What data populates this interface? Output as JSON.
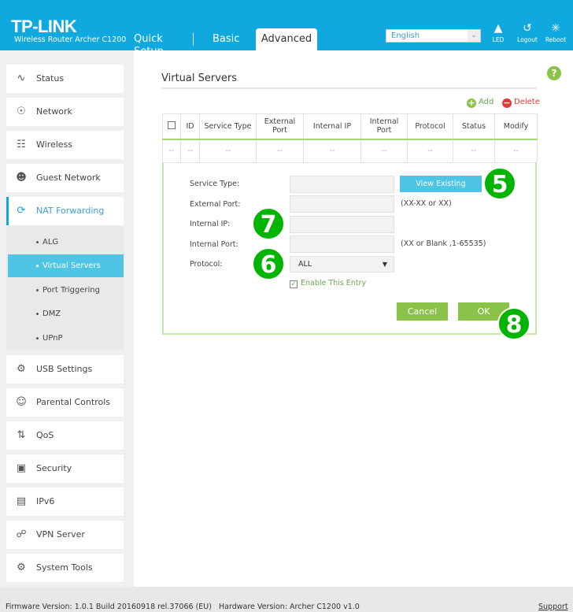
{
  "header": {
    "logo": "TP-LINK",
    "model": "Wireless Router Archer C1200",
    "tabs": [
      {
        "label": "Quick Setup"
      },
      {
        "label": "Basic"
      },
      {
        "label": "Advanced"
      }
    ],
    "language": "English",
    "icons": [
      {
        "label": "LED",
        "icon": "bell-icon"
      },
      {
        "label": "Logout",
        "icon": "logout-icon"
      },
      {
        "label": "Reboot",
        "icon": "reboot-icon"
      }
    ],
    "accent": "#0fa9df"
  },
  "sidebar": {
    "items": [
      {
        "label": "Status"
      },
      {
        "label": "Network"
      },
      {
        "label": "Wireless"
      },
      {
        "label": "Guest Network"
      },
      {
        "label": "NAT Forwarding"
      },
      {
        "label": "USB Settings"
      },
      {
        "label": "Parental Controls"
      },
      {
        "label": "QoS"
      },
      {
        "label": "Security"
      },
      {
        "label": "IPv6"
      },
      {
        "label": "VPN Server"
      },
      {
        "label": "System Tools"
      }
    ],
    "sub": [
      {
        "label": "ALG"
      },
      {
        "label": "Virtual Servers"
      },
      {
        "label": "Port Triggering"
      },
      {
        "label": "DMZ"
      },
      {
        "label": "UPnP"
      }
    ]
  },
  "main": {
    "title": "Virtual Servers",
    "help": "?",
    "add": "Add",
    "delete": "Delete",
    "columns": [
      "ID",
      "Service Type",
      "External Port",
      "Internal IP",
      "Internal Port",
      "Protocol",
      "Status",
      "Modify"
    ],
    "row": [
      "--",
      "--",
      "--",
      "--",
      "--",
      "--",
      "--",
      "--",
      "--"
    ],
    "form": {
      "service_type": "Service Type:",
      "external_port": "External Port:",
      "internal_ip": "Internal IP:",
      "internal_port": "Internal Port:",
      "protocol": "Protocol:",
      "view_existing": "View Existing Services",
      "ext_hint": "(XX-XX or XX)",
      "int_hint": "(XX or Blank ,1-65535)",
      "protocol_value": "ALL",
      "enable": "Enable This Entry",
      "cancel": "Cancel",
      "ok": "OK"
    }
  },
  "annotations": [
    "5",
    "7",
    "6",
    "8"
  ],
  "footer": {
    "firmware": "Firmware Version: 1.0.1 Build 20160918 rel.37066 (EU)",
    "hardware": "Hardware Version: Archer C1200 v1.0",
    "support": "Support"
  }
}
